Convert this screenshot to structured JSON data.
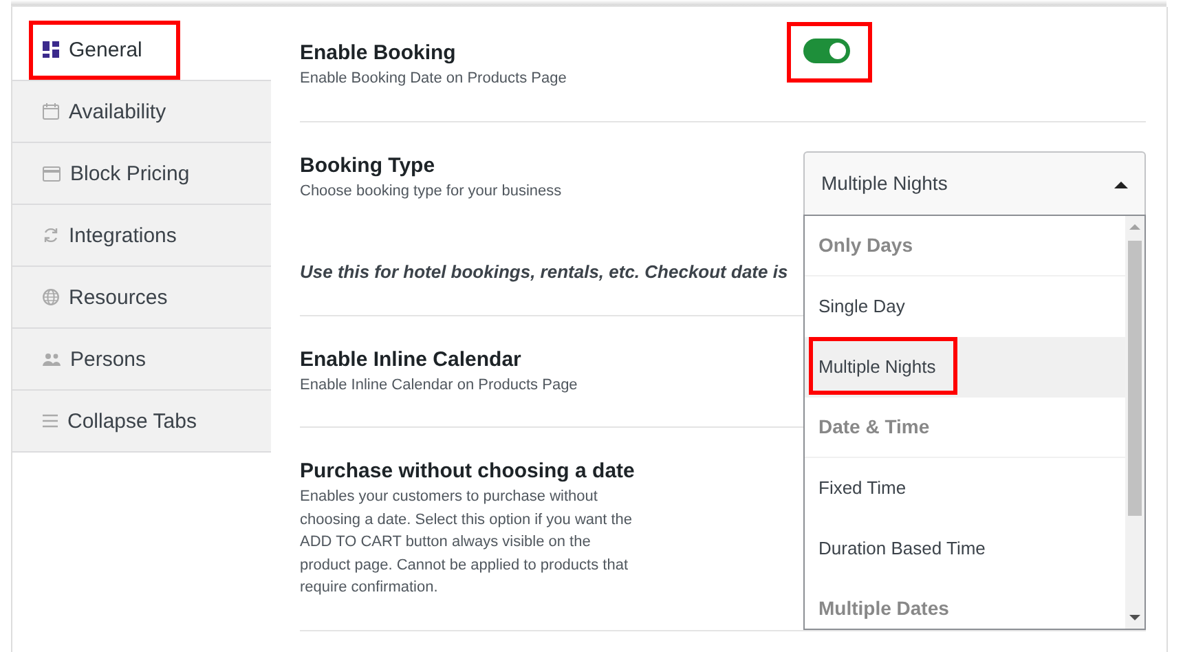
{
  "sidebar": {
    "items": [
      {
        "label": "General",
        "selected": true,
        "highlighted": true
      },
      {
        "label": "Availability",
        "selected": false,
        "highlighted": false
      },
      {
        "label": "Block Pricing",
        "selected": false,
        "highlighted": false
      },
      {
        "label": "Integrations",
        "selected": false,
        "highlighted": false
      },
      {
        "label": "Resources",
        "selected": false,
        "highlighted": false
      },
      {
        "label": "Persons",
        "selected": false,
        "highlighted": false
      },
      {
        "label": "Collapse Tabs",
        "selected": false,
        "highlighted": false
      }
    ]
  },
  "settings": [
    {
      "kind": "toggle",
      "title": "Enable Booking",
      "description": "Enable Booking Date on Products Page",
      "on": true,
      "highlighted": true
    },
    {
      "kind": "select",
      "title": "Booking Type",
      "description": "Choose booking type for your business",
      "note": "Use this for hotel bookings, rentals, etc. Checkout date is",
      "value": "Multiple Nights",
      "expanded": true,
      "options": [
        {
          "kind": "group",
          "label": "Only Days"
        },
        {
          "kind": "option",
          "label": "Single Day",
          "selected": false,
          "highlighted": false
        },
        {
          "kind": "option",
          "label": "Multiple Nights",
          "selected": true,
          "highlighted": true
        },
        {
          "kind": "group",
          "label": "Date & Time"
        },
        {
          "kind": "option",
          "label": "Fixed Time",
          "selected": false,
          "highlighted": false
        },
        {
          "kind": "option",
          "label": "Duration Based Time",
          "selected": false,
          "highlighted": false
        },
        {
          "kind": "group",
          "label": "Multiple Dates"
        }
      ]
    },
    {
      "kind": "plain",
      "title": "Enable Inline Calendar",
      "description": "Enable Inline Calendar on Products Page"
    },
    {
      "kind": "plain",
      "title": "Purchase without choosing a date",
      "description": "Enables your customers to purchase without choosing a date. Select this option if you want the ADD TO CART button always visible on the product page. Cannot be applied to products that require confirmation."
    }
  ]
}
